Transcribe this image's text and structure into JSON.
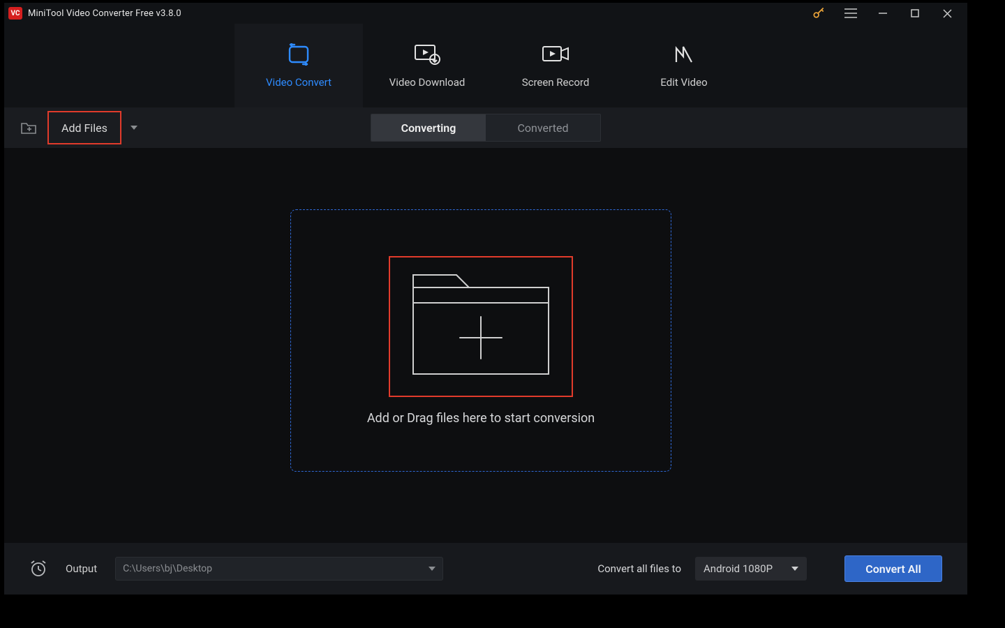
{
  "titlebar": {
    "logo_text": "VC",
    "title": "MiniTool Video Converter Free v3.8.0"
  },
  "nav": {
    "tabs": [
      {
        "label": "Video Convert"
      },
      {
        "label": "Video Download"
      },
      {
        "label": "Screen Record"
      },
      {
        "label": "Edit Video"
      }
    ]
  },
  "toolbar": {
    "add_files_label": "Add Files",
    "segments": [
      {
        "label": "Converting"
      },
      {
        "label": "Converted"
      }
    ]
  },
  "dropzone": {
    "hint": "Add or Drag files here to start conversion"
  },
  "footer": {
    "output_label": "Output",
    "output_path": "C:\\Users\\bj\\Desktop",
    "convert_all_label": "Convert all files to",
    "format_selected": "Android 1080P",
    "convert_all_button": "Convert All"
  }
}
